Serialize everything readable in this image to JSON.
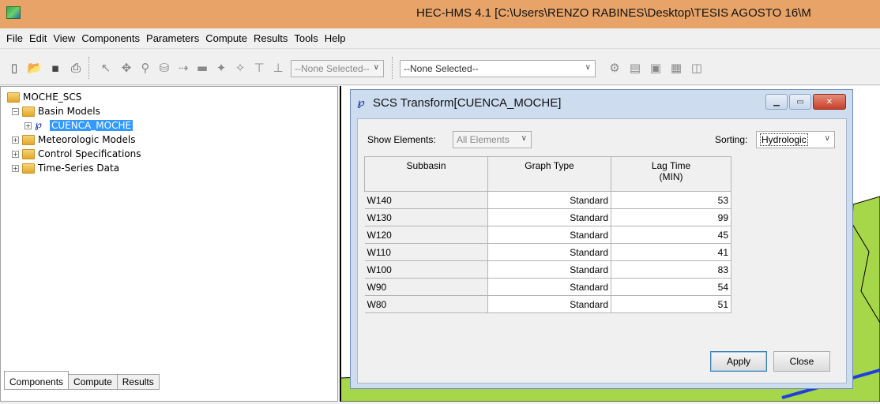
{
  "window": {
    "title": "HEC-HMS 4.1 [C:\\Users\\RENZO RABINES\\Desktop\\TESIS AGOSTO 16\\M"
  },
  "menu": [
    "File",
    "Edit",
    "View",
    "Components",
    "Parameters",
    "Compute",
    "Results",
    "Tools",
    "Help"
  ],
  "toolbar": {
    "select_1": "--None Selected--",
    "select_2": "--None Selected--"
  },
  "tree": {
    "root": "MOCHE_SCS",
    "basin_models": "Basin Models",
    "basin": "CUENCA_MOCHE",
    "meteorologic": "Meteorologic Models",
    "control": "Control Specifications",
    "timeseries": "Time-Series Data"
  },
  "tabs": [
    "Components",
    "Compute",
    "Results"
  ],
  "dialog": {
    "title": "SCS Transform[CUENCA_MOCHE]",
    "show_elements_label": "Show Elements:",
    "show_elements_value": "All Elements",
    "sorting_label": "Sorting:",
    "sorting_value": "Hydrologic",
    "columns": [
      "Subbasin",
      "Graph Type",
      "Lag Time",
      "(MIN)"
    ],
    "rows": [
      {
        "subbasin": "W140",
        "graph": "Standard",
        "lag": "53"
      },
      {
        "subbasin": "W130",
        "graph": "Standard",
        "lag": "99"
      },
      {
        "subbasin": "W120",
        "graph": "Standard",
        "lag": "45"
      },
      {
        "subbasin": "W110",
        "graph": "Standard",
        "lag": "41"
      },
      {
        "subbasin": "W100",
        "graph": "Standard",
        "lag": "83"
      },
      {
        "subbasin": "W90",
        "graph": "Standard",
        "lag": "54"
      },
      {
        "subbasin": "W80",
        "graph": "Standard",
        "lag": "51"
      }
    ],
    "apply": "Apply",
    "close": "Close"
  }
}
